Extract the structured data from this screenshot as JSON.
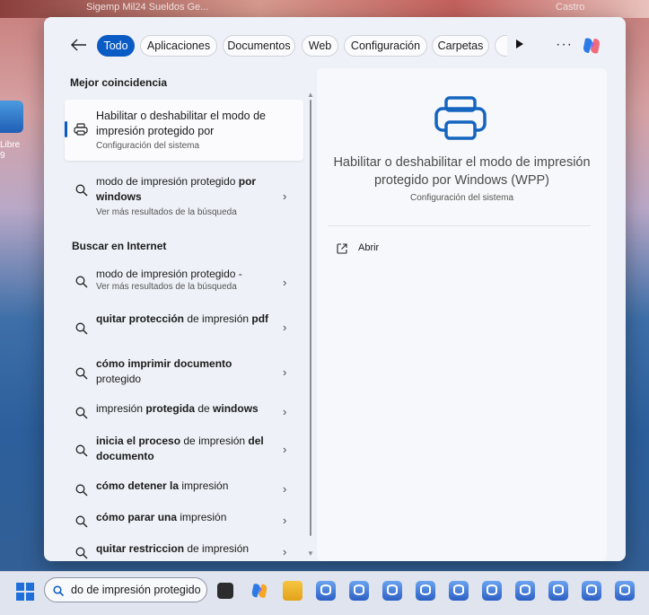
{
  "wallpaper": {
    "top_text_left": "Sigemp Mil24 Sueldos Ge...",
    "top_text_right": "Castro",
    "desktop_label_line1": "Libre",
    "desktop_label_line2": "9"
  },
  "filters": {
    "chips": [
      "Todo",
      "Aplicaciones",
      "Documentos",
      "Web",
      "Configuración",
      "Carpetas"
    ],
    "active": "Todo",
    "more": "···"
  },
  "results": {
    "best_match_heading": "Mejor coincidencia",
    "best_match": {
      "title": "Habilitar o deshabilitar el modo de impresión protegido por",
      "subtitle": "Configuración del sistema",
      "icon": "printer-icon"
    },
    "search_more": {
      "text_plain": "modo de impresión protegido ",
      "text_bold": "por windows",
      "subtitle": "Ver más resultados de la búsqueda"
    },
    "internet_heading": "Buscar en Internet",
    "internet_items": [
      {
        "parts": [
          {
            "t": "modo de impresión protegido -",
            "b": false
          }
        ],
        "sub": "Ver más resultados de la búsqueda"
      },
      {
        "parts": [
          {
            "t": "quitar protección",
            "b": true
          },
          {
            "t": " de impresión ",
            "b": false
          },
          {
            "t": "pdf",
            "b": true
          }
        ],
        "sub": ""
      },
      {
        "parts": [
          {
            "t": "cómo imprimir documento",
            "b": true
          },
          {
            "t": " protegido",
            "b": false
          }
        ],
        "sub": ""
      },
      {
        "parts": [
          {
            "t": "impresión ",
            "b": false
          },
          {
            "t": "protegida",
            "b": true
          },
          {
            "t": " de ",
            "b": false
          },
          {
            "t": "windows",
            "b": true
          }
        ],
        "sub": ""
      },
      {
        "parts": [
          {
            "t": "inicia el proceso",
            "b": true
          },
          {
            "t": " de impresión ",
            "b": false
          },
          {
            "t": "del documento",
            "b": true
          }
        ],
        "sub": ""
      },
      {
        "parts": [
          {
            "t": "cómo detener la",
            "b": true
          },
          {
            "t": " impresión",
            "b": false
          }
        ],
        "sub": ""
      },
      {
        "parts": [
          {
            "t": "cómo parar una",
            "b": true
          },
          {
            "t": " impresión",
            "b": false
          }
        ],
        "sub": ""
      },
      {
        "parts": [
          {
            "t": "quitar restriccion",
            "b": true
          },
          {
            "t": " de impresión",
            "b": false
          }
        ],
        "sub": ""
      }
    ]
  },
  "preview": {
    "title": "Habilitar o deshabilitar el modo de impresión protegido por Windows (WPP)",
    "subtitle": "Configuración del sistema",
    "open_label": "Abrir",
    "icon": "printer-icon"
  },
  "taskbar": {
    "search_value": "do de impresión protegido",
    "apps": [
      "task-view-icon",
      "copilot-icon",
      "file-explorer-icon",
      "db-app-icon"
    ]
  },
  "colors": {
    "accent": "#0a5bc4",
    "panel": "#eef1f7"
  }
}
